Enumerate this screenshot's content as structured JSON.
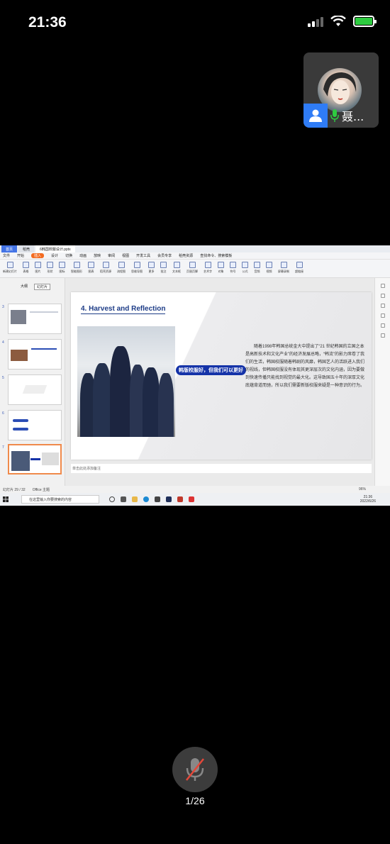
{
  "status_bar": {
    "time": "21:36"
  },
  "call_pip": {
    "caller_name": "聂..."
  },
  "wps": {
    "tabs": {
      "home": "首页",
      "mail": "稻壳",
      "document": "6韩国校服设计.pptx"
    },
    "menu": [
      "文件",
      "开始",
      "插入",
      "设计",
      "切换",
      "动画",
      "放映",
      "审阅",
      "视图",
      "开发工具",
      "会员专享",
      "稻壳资源",
      "查找命令、搜索模板"
    ],
    "active_menu": "插入",
    "ribbon": [
      "新建幻灯片",
      "表格",
      "图片",
      "形状",
      "图标",
      "智能图形",
      "图表",
      "稻壳资源",
      "流程图",
      "思维导图",
      "更多",
      "批注",
      "文本框",
      "页眉页脚",
      "艺术字",
      "对象",
      "符号",
      "公式",
      "音频",
      "视频",
      "屏幕录制",
      "超链接"
    ],
    "panel_tabs": [
      "大纲",
      "幻灯片"
    ],
    "thumb_numbers": [
      "3",
      "4",
      "5",
      "6",
      "7"
    ],
    "slide": {
      "title": "4. Harvest and Reflection",
      "caption": "韩版校服好，但我们可以更好",
      "body": "随着1998年韩国总统金大中提出了“21 世纪韩国的立国之本是高新技术和文化产业”的经济发展总略，“韩流”的影力席卷了我们的生活，韩国校服随着韩剧的风靡，韩国艺人的活跃进入我们的视线，但韩国校服没有体现其更深层次的文化内涵，因为要做到快速传播只能找到视觉的最大化。这导致国五十年的深厚文化底蕴背道而驰，所以我们需要新版校服来疑是一种意识的行为。"
    },
    "notes_placeholder": "单击此处添加备注",
    "status": {
      "slide_index": "幻灯片 29 / 32",
      "theme": "Office 主题",
      "zoom": "96%"
    },
    "taskbar": {
      "search_placeholder": "在这里输入你要搜索的内容",
      "time": "21:36",
      "date": "2022/6/26"
    }
  },
  "share": {
    "page": "1/26"
  }
}
